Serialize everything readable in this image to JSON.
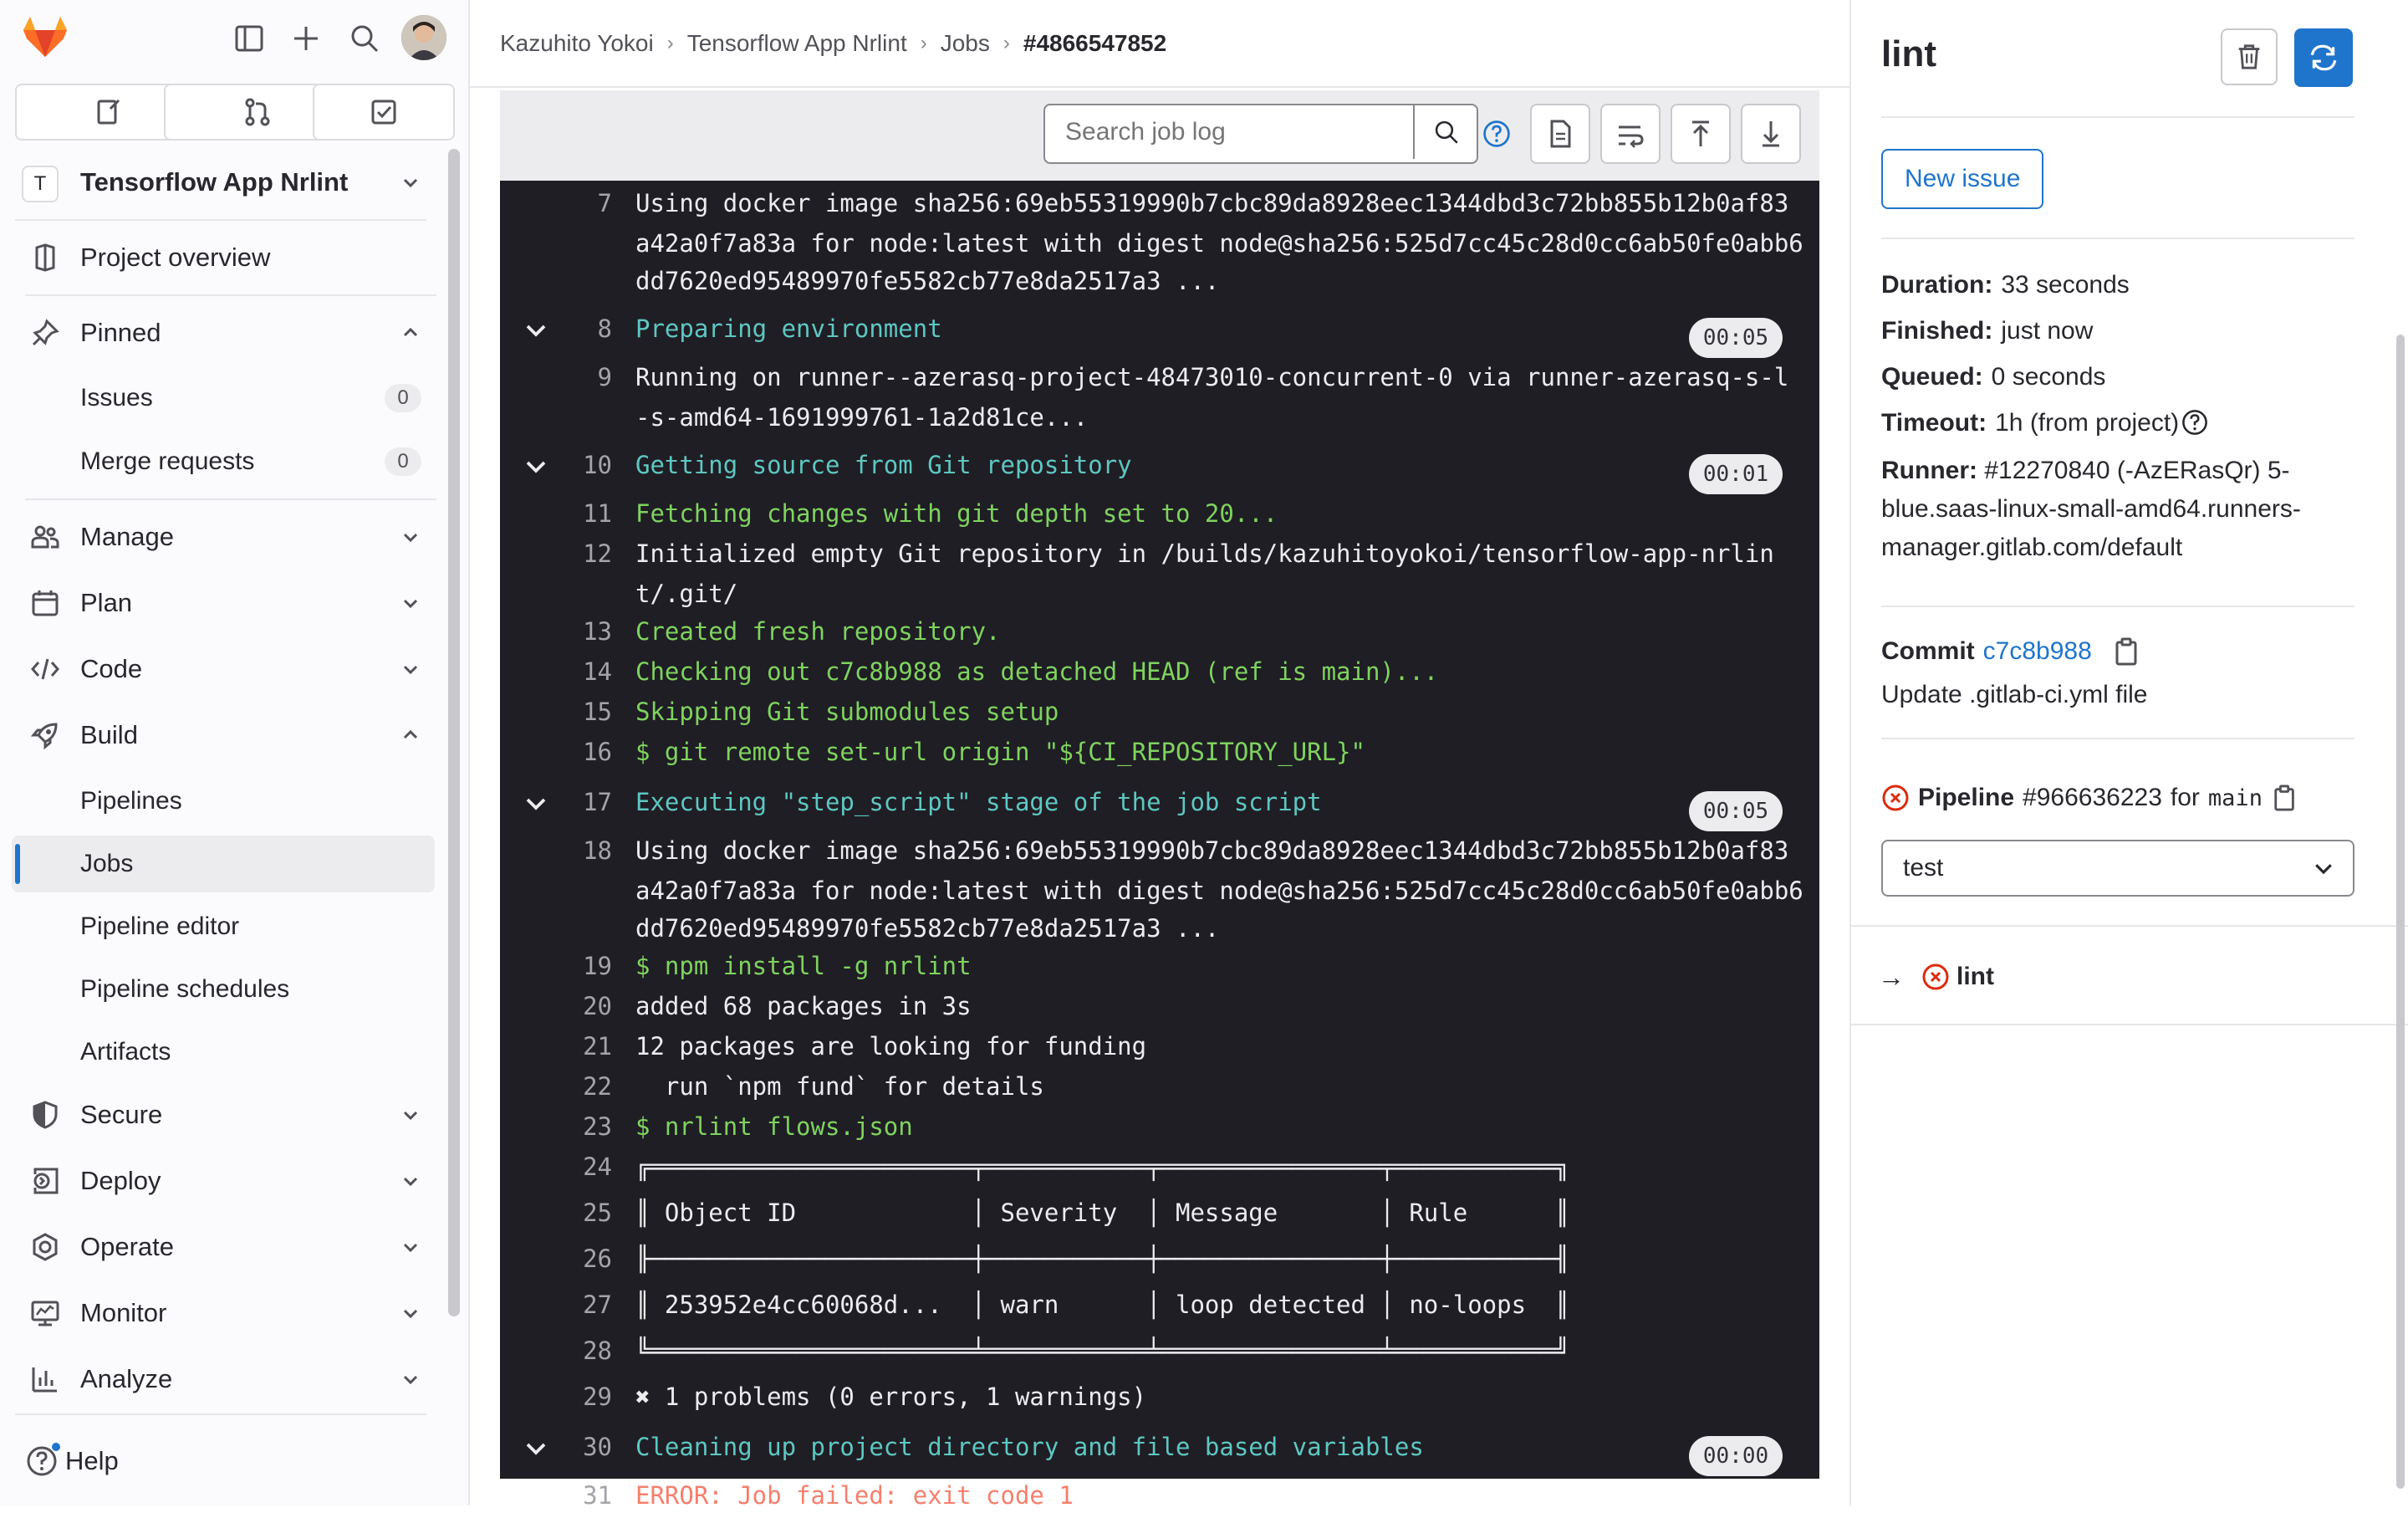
{
  "sidebar": {
    "project_initial": "T",
    "project_name": "Tensorflow App Nrlint",
    "items": [
      {
        "label": "Project overview",
        "icon": "project-icon"
      },
      {
        "label": "Pinned",
        "icon": "pin-icon"
      },
      {
        "label": "Manage",
        "icon": "users-icon"
      },
      {
        "label": "Plan",
        "icon": "calendar-icon"
      },
      {
        "label": "Code",
        "icon": "code-icon"
      },
      {
        "label": "Build",
        "icon": "rocket-icon"
      },
      {
        "label": "Secure",
        "icon": "shield-icon"
      },
      {
        "label": "Deploy",
        "icon": "deploy-icon"
      },
      {
        "label": "Operate",
        "icon": "cloud-gear-icon"
      },
      {
        "label": "Monitor",
        "icon": "monitor-icon"
      },
      {
        "label": "Analyze",
        "icon": "chart-icon"
      }
    ],
    "pinned": [
      {
        "label": "Issues",
        "count": "0"
      },
      {
        "label": "Merge requests",
        "count": "0"
      }
    ],
    "build_sub": [
      "Pipelines",
      "Jobs",
      "Pipeline editor",
      "Pipeline schedules",
      "Artifacts"
    ],
    "help_label": "Help"
  },
  "breadcrumb": [
    "Kazuhito Yokoi",
    "Tensorflow App Nrlint",
    "Jobs",
    "#4866547852"
  ],
  "log_search": {
    "placeholder": "Search job log"
  },
  "log_lines": [
    {
      "n": "7",
      "text": "Using docker image sha256:69eb55319990b7cbc89da8928eec1344dbd3c72bb855b12b0af83",
      "cls": "white"
    },
    {
      "n": "",
      "text": "a42a0f7a83a for node:latest with digest node@sha256:525d7cc45c28d0cc6ab50fe0abb6",
      "cls": "white"
    },
    {
      "n": "",
      "text": "dd7620ed95489970fe5582cb77e8da2517a3 ...",
      "cls": "white"
    },
    {
      "n": "8",
      "text": "Preparing environment",
      "cls": "cyan",
      "dur": "00:05"
    },
    {
      "n": "9",
      "text": "Running on runner--azerasq-project-48473010-concurrent-0 via runner-azerasq-s-l",
      "cls": "white"
    },
    {
      "n": "",
      "text": "-s-amd64-1691999761-1a2d81ce...",
      "cls": "white"
    },
    {
      "n": "10",
      "text": "Getting source from Git repository",
      "cls": "cyan",
      "dur": "00:01"
    },
    {
      "n": "11",
      "text": "Fetching changes with git depth set to 20...",
      "cls": "green"
    },
    {
      "n": "12",
      "text": "Initialized empty Git repository in /builds/kazuhitoyokoi/tensorflow-app-nrlin",
      "cls": "white"
    },
    {
      "n": "",
      "text": "t/.git/",
      "cls": "white"
    },
    {
      "n": "13",
      "text": "Created fresh repository.",
      "cls": "green"
    },
    {
      "n": "14",
      "text": "Checking out c7c8b988 as detached HEAD (ref is main)...",
      "cls": "green"
    },
    {
      "n": "15",
      "text": "Skipping Git submodules setup",
      "cls": "green"
    },
    {
      "n": "16",
      "text": "$ git remote set-url origin \"${CI_REPOSITORY_URL}\"",
      "cls": "green"
    },
    {
      "n": "17",
      "text": "Executing \"step_script\" stage of the job script",
      "cls": "cyan",
      "dur": "00:05"
    },
    {
      "n": "18",
      "text": "Using docker image sha256:69eb55319990b7cbc89da8928eec1344dbd3c72bb855b12b0af83",
      "cls": "white"
    },
    {
      "n": "",
      "text": "a42a0f7a83a for node:latest with digest node@sha256:525d7cc45c28d0cc6ab50fe0abb6",
      "cls": "white"
    },
    {
      "n": "",
      "text": "dd7620ed95489970fe5582cb77e8da2517a3 ...",
      "cls": "white"
    },
    {
      "n": "19",
      "text": "$ npm install -g nrlint",
      "cls": "green"
    },
    {
      "n": "20",
      "text": "added 68 packages in 3s",
      "cls": "white"
    },
    {
      "n": "21",
      "text": "12 packages are looking for funding",
      "cls": "white"
    },
    {
      "n": "22",
      "text": "  run `npm fund` for details",
      "cls": "white"
    },
    {
      "n": "23",
      "text": "$ nrlint flows.json",
      "cls": "green"
    },
    {
      "n": "24",
      "text": "╔══════════════════════╤═══════════╤═══════════════╤═══════════╗",
      "cls": "white"
    },
    {
      "n": "25",
      "text": "║ Object ID            │ Severity  │ Message       │ Rule      ║",
      "cls": "white"
    },
    {
      "n": "26",
      "text": "╟──────────────────────┼───────────┼───────────────┼───────────╢",
      "cls": "white"
    },
    {
      "n": "27",
      "text": "║ 253952e4cc60068d...  │ warn      │ loop detected │ no-loops  ║",
      "cls": "white"
    },
    {
      "n": "28",
      "text": "╚══════════════════════╧═══════════╧═══════════════╧═══════════╝",
      "cls": "white"
    },
    {
      "n": "29",
      "text": "✖ 1 problems (0 errors, 1 warnings)",
      "cls": "white"
    },
    {
      "n": "30",
      "text": "Cleaning up project directory and file based variables",
      "cls": "cyan",
      "dur": "00:00"
    },
    {
      "n": "31",
      "text": "ERROR: Job failed: exit code 1",
      "cls": "red"
    }
  ],
  "job": {
    "title": "lint",
    "new_issue_label": "New issue",
    "details": [
      {
        "label": "Duration:",
        "value": "33 seconds"
      },
      {
        "label": "Finished:",
        "value": "just now"
      },
      {
        "label": "Queued:",
        "value": "0 seconds"
      },
      {
        "label": "Timeout:",
        "value": "1h (from project)"
      }
    ],
    "runner_label": "Runner:",
    "runner_lines": [
      "#12270840 (-AzERasQr) 5-",
      "blue.saas-linux-small-amd64.runners-",
      "manager.gitlab.com/default"
    ],
    "commit_label": "Commit",
    "commit_sha": "c7c8b988",
    "commit_message": "Update .gitlab-ci.yml file",
    "pipeline_label": "Pipeline",
    "pipeline_id": "#966636223",
    "pipeline_for": "for",
    "pipeline_branch": "main",
    "stage_selected": "test",
    "stage_job": "lint"
  },
  "colors": {
    "accent": "#1f75cb",
    "danger": "#dd2b0e",
    "log_bg": "#1f1e24"
  }
}
